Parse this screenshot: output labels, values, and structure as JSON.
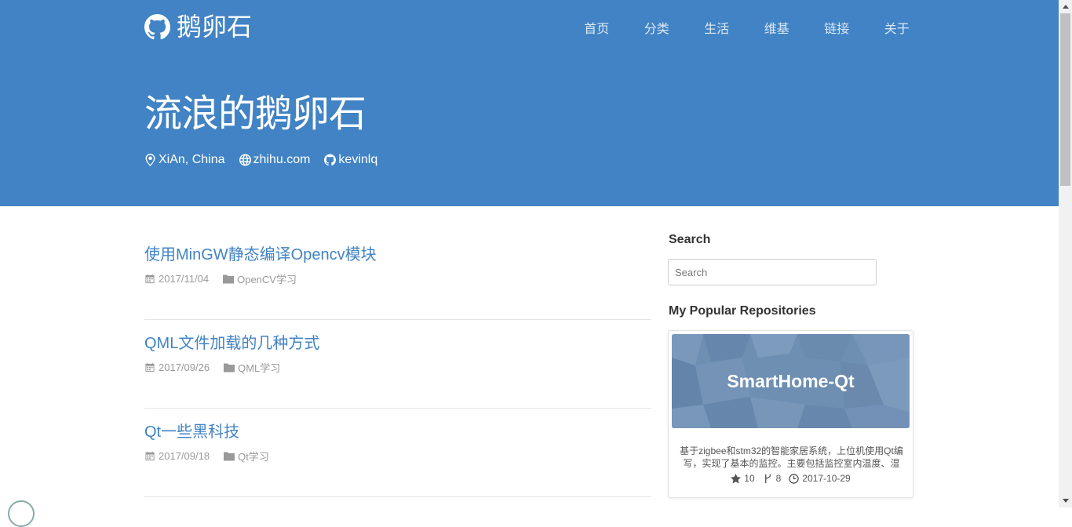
{
  "header": {
    "brand": "鹅卵石",
    "nav": [
      "首页",
      "分类",
      "生活",
      "维基",
      "链接",
      "关于"
    ],
    "title": "流浪的鹅卵石",
    "location": "XiAn, China",
    "website": "zhihu.com",
    "github": "kevinlq"
  },
  "posts": [
    {
      "title": "使用MinGW静态编译Opencv模块",
      "date": "2017/11/04",
      "category": "OpenCV学习"
    },
    {
      "title": "QML文件加载的几种方式",
      "date": "2017/09/26",
      "category": "QML学习"
    },
    {
      "title": "Qt一些黑科技",
      "date": "2017/09/18",
      "category": "Qt学习"
    }
  ],
  "sidebar": {
    "search_heading": "Search",
    "search_placeholder": "Search",
    "repos_heading": "My Popular Repositories",
    "repo": {
      "name": "SmartHome-Qt",
      "description": "基于zigbee和stm32的智能家居系统，上位机使用Qt编写，实现了基本的监控。主要包括监控室内温度、湿",
      "stars": "10",
      "forks": "8",
      "updated": "2017-10-29"
    }
  },
  "colors": {
    "header_bg": "#4183c4",
    "link": "#4183c4",
    "banner": "#6f8fb3"
  }
}
